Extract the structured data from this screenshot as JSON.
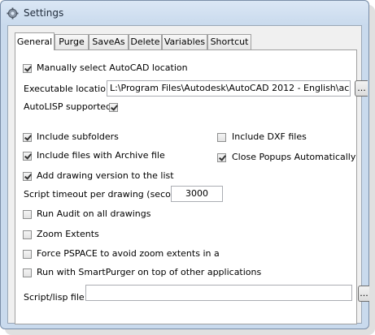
{
  "window": {
    "title": "Settings"
  },
  "tabs": [
    "General",
    "Purge",
    "SaveAs",
    "Delete",
    "Variables",
    "Shortcut"
  ],
  "general": {
    "manual_select": {
      "label": "Manually select AutoCAD location",
      "checked": true
    },
    "executable_label": "Executable location:",
    "executable_value": "L:\\Program Files\\Autodesk\\AutoCAD 2012 - English\\acad.exe",
    "browse_label": "...",
    "autolisp_label": "AutoLISP supported:",
    "autolisp_checked": true,
    "include_subfolders": {
      "label": "Include subfolders",
      "checked": true
    },
    "include_dxf": {
      "label": "Include DXF files",
      "checked": false
    },
    "include_archive": {
      "label": "Include files with Archive file",
      "checked": true
    },
    "close_popups": {
      "label": "Close Popups Automatically",
      "checked": true
    },
    "add_version": {
      "label": "Add drawing version to the list",
      "checked": true
    },
    "timeout_label": "Script timeout per drawing (seconds)",
    "timeout_value": "3000",
    "run_audit": {
      "label": "Run Audit on all drawings",
      "checked": false
    },
    "zoom_extents": {
      "label": "Zoom Extents",
      "checked": false
    },
    "force_pspace": {
      "label": "Force PSPACE to avoid zoom extents in a",
      "checked": false
    },
    "smartpurger_top": {
      "label": "Run with SmartPurger on top of other applications",
      "checked": false
    },
    "script_label": "Script/lisp file:",
    "script_value": "",
    "script_browse_label": "..."
  }
}
